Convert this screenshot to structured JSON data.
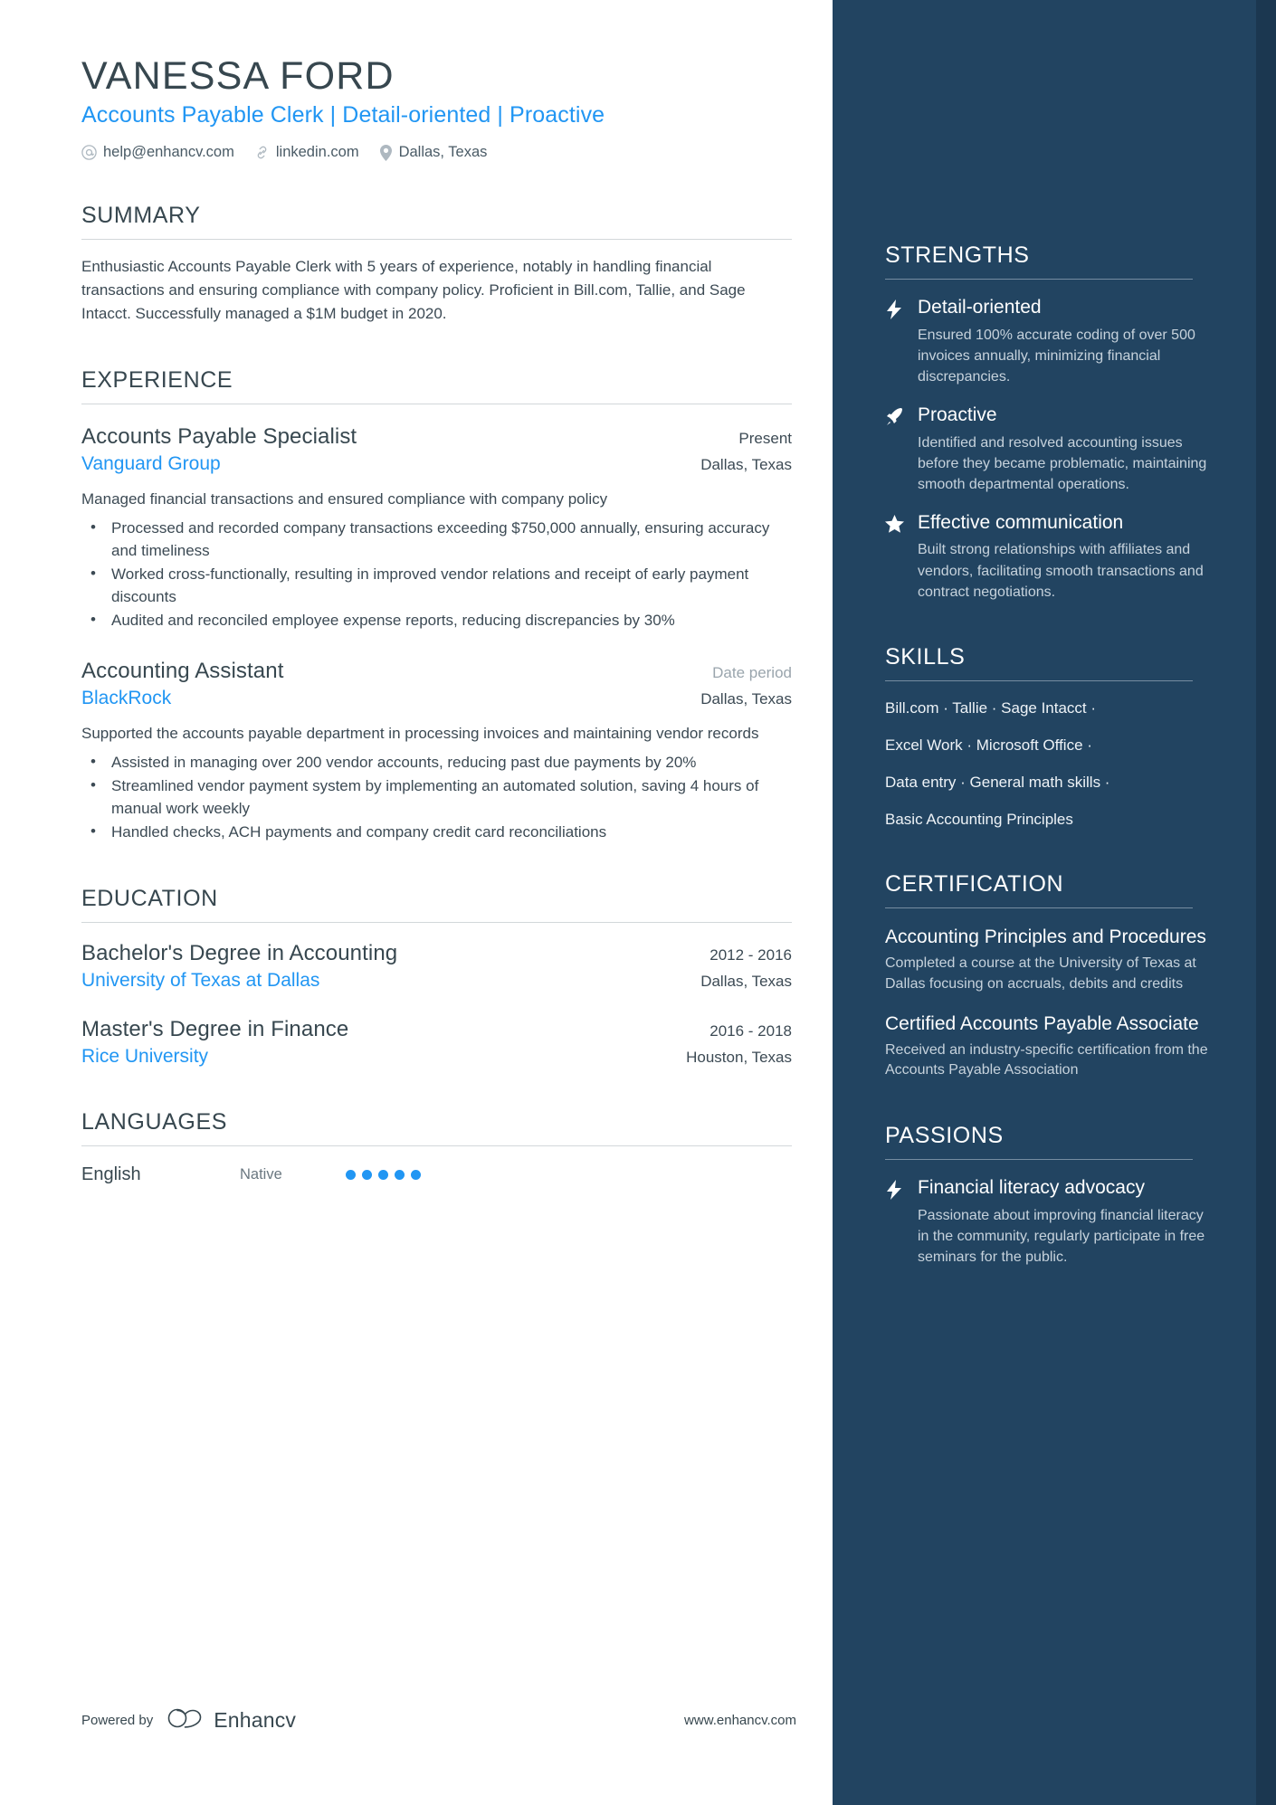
{
  "header": {
    "name": "VANESSA FORD",
    "headline": "Accounts Payable Clerk | Detail-oriented | Proactive",
    "contacts": [
      {
        "icon": "at-icon",
        "text": "help@enhancv.com"
      },
      {
        "icon": "link-icon",
        "text": "linkedin.com"
      },
      {
        "icon": "location-pin-icon",
        "text": "Dallas, Texas"
      }
    ]
  },
  "summary": {
    "title": "SUMMARY",
    "text": "Enthusiastic Accounts Payable Clerk with 5 years of experience, notably in handling financial transactions and ensuring compliance with company policy. Proficient in Bill.com, Tallie, and Sage Intacct. Successfully managed a $1M budget in 2020."
  },
  "experience": {
    "title": "EXPERIENCE",
    "entries": [
      {
        "role": "Accounts Payable Specialist",
        "date": "Present",
        "date_muted": false,
        "company": "Vanguard Group",
        "location": "Dallas, Texas",
        "description": "Managed financial transactions and ensured compliance with company policy",
        "bullets": [
          "Processed and recorded company transactions exceeding $750,000 annually, ensuring accuracy and timeliness",
          "Worked cross-functionally, resulting in improved vendor relations and receipt of early payment discounts",
          "Audited and reconciled employee expense reports, reducing discrepancies by 30%"
        ]
      },
      {
        "role": "Accounting Assistant",
        "date": "Date period",
        "date_muted": true,
        "company": "BlackRock",
        "location": "Dallas, Texas",
        "description": "Supported the accounts payable department in processing invoices and maintaining vendor records",
        "bullets": [
          "Assisted in managing over 200 vendor accounts, reducing past due payments by 20%",
          "Streamlined vendor payment system by implementing an automated solution, saving 4 hours of manual work weekly",
          "Handled checks, ACH payments and company credit card reconciliations"
        ]
      }
    ]
  },
  "education": {
    "title": "EDUCATION",
    "entries": [
      {
        "degree": "Bachelor's Degree in Accounting",
        "date": "2012 - 2016",
        "school": "University of Texas at Dallas",
        "location": "Dallas, Texas"
      },
      {
        "degree": "Master's Degree in Finance",
        "date": "2016 - 2018",
        "school": "Rice University",
        "location": "Houston, Texas"
      }
    ]
  },
  "languages": {
    "title": "LANGUAGES",
    "entries": [
      {
        "name": "English",
        "level": "Native",
        "dots_filled": 5,
        "dots_total": 5
      }
    ]
  },
  "strengths": {
    "title": "STRENGTHS",
    "items": [
      {
        "icon": "lightning-bolt-icon",
        "title": "Detail-oriented",
        "text": "Ensured 100% accurate coding of over 500 invoices annually, minimizing financial discrepancies."
      },
      {
        "icon": "rocket-icon",
        "title": "Proactive",
        "text": "Identified and resolved accounting issues before they became problematic, maintaining smooth departmental operations."
      },
      {
        "icon": "star-icon",
        "title": "Effective communication",
        "text": "Built strong relationships with affiliates and vendors, facilitating smooth transactions and contract negotiations."
      }
    ]
  },
  "skills": {
    "title": "SKILLS",
    "lines": [
      "Bill.com · Tallie · Sage Intacct ·",
      "Excel Work · Microsoft Office ·",
      "Data entry · General math skills ·",
      "Basic Accounting Principles"
    ]
  },
  "certification": {
    "title": "CERTIFICATION",
    "items": [
      {
        "title": "Accounting Principles and Procedures",
        "text": "Completed a course at the University of Texas at Dallas focusing on accruals, debits and credits"
      },
      {
        "title": "Certified Accounts Payable Associate",
        "text": "Received an industry-specific certification from the Accounts Payable Association"
      }
    ]
  },
  "passions": {
    "title": "PASSIONS",
    "items": [
      {
        "icon": "lightning-bolt-icon",
        "title": "Financial literacy advocacy",
        "text": "Passionate about improving financial literacy in the community, regularly participate in free seminars for the public."
      }
    ]
  },
  "footer": {
    "powered_by": "Powered by",
    "brand": "Enhancv",
    "website": "www.enhancv.com"
  },
  "colors": {
    "accent_blue": "#2196f3",
    "sidebar_bg": "#224461",
    "sidebar_strip": "#1b3750",
    "heading_gray": "#37474f"
  }
}
